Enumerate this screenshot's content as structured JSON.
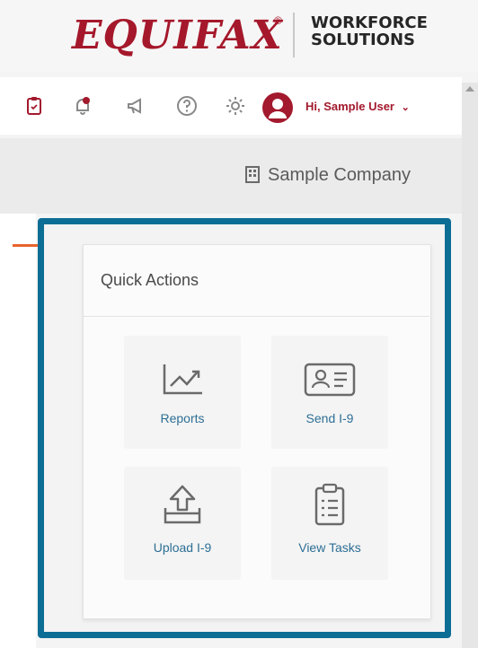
{
  "brand": {
    "logo_text": "EQUIFAX",
    "registered_mark": "®",
    "division_line1": "WORKFORCE",
    "division_line2": "SOLUTIONS"
  },
  "toolbar": {
    "icons": [
      "clipboard-icon",
      "notification-bell-icon",
      "megaphone-icon",
      "help-icon",
      "settings-gear-icon"
    ],
    "user_greeting": "Hi, Sample User",
    "accent_color": "#a3192d"
  },
  "company": {
    "name": "Sample Company",
    "icon": "building-icon"
  },
  "quick_actions": {
    "title": "Quick Actions",
    "frame_color": "#0d6e95",
    "items": [
      {
        "label": "Reports",
        "icon": "reports-chart-icon"
      },
      {
        "label": "Send I-9",
        "icon": "id-card-icon"
      },
      {
        "label": "Upload I-9",
        "icon": "upload-icon"
      },
      {
        "label": "View Tasks",
        "icon": "task-clipboard-icon"
      }
    ]
  }
}
